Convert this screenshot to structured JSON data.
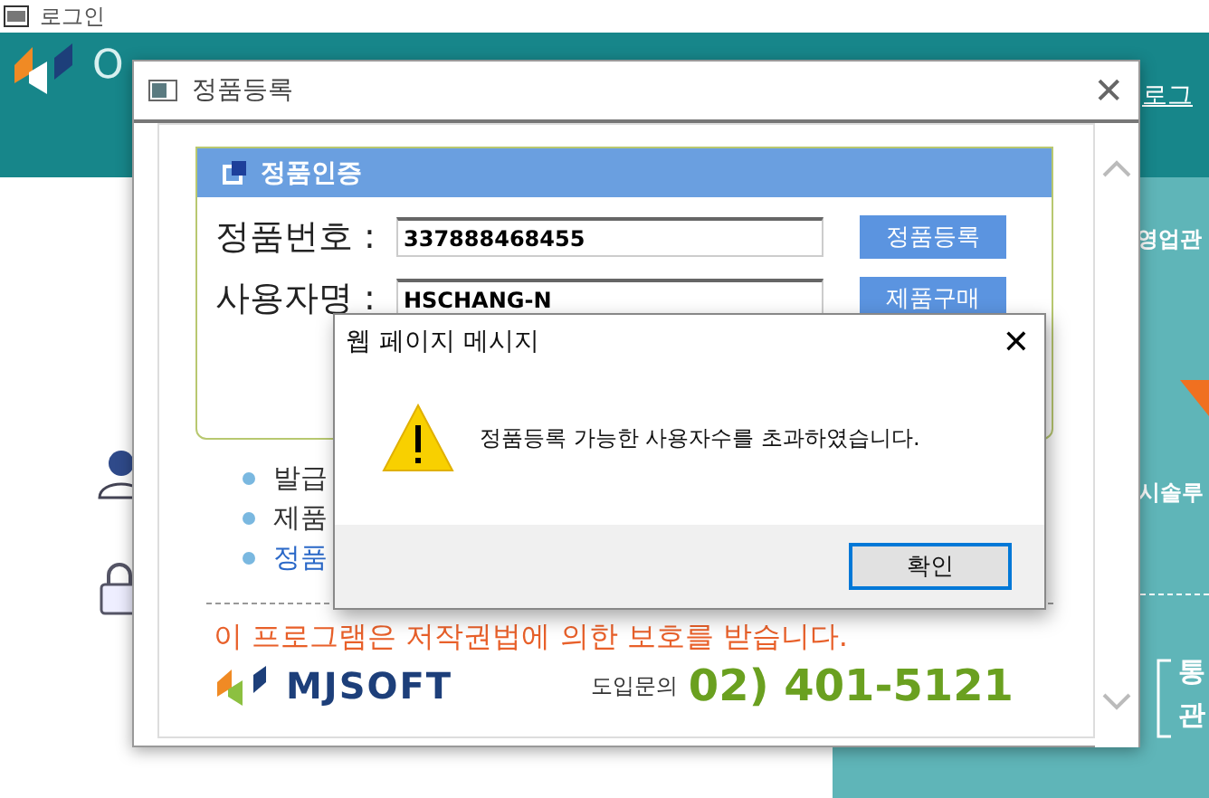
{
  "background_app": {
    "title": "로그인",
    "header_logo_text": "O",
    "login_link": "로그",
    "side_texts": [
      {
        "text": "영업관",
        "kind": "heading"
      },
      {
        "text": "시솔루",
        "kind": "heading"
      },
      {
        "text": "통",
        "kind": "bracket"
      },
      {
        "text": "관",
        "kind": "bracket"
      }
    ]
  },
  "registration_window": {
    "title": "정품등록",
    "close_icon": "✕",
    "panel_title": "정품인증",
    "fields": [
      {
        "label": "정품번호 :",
        "value": "337888468455",
        "button": "정품등록"
      },
      {
        "label": "사용자명 :",
        "value": "HSCHANG-N",
        "button": "제품구매"
      }
    ],
    "bullets": [
      {
        "text": "발급",
        "kind": "text"
      },
      {
        "text": "제품",
        "kind": "text"
      },
      {
        "text": "정품",
        "kind": "link"
      }
    ],
    "notice": "이 프로그램은 저작권법에 의한 보호를 받습니다.",
    "logo_text": "MJSOFT",
    "contact_label": "도입문의",
    "contact_phone": "02) 401-5121"
  },
  "message_dialog": {
    "title": "웹 페이지 메시지",
    "close_icon": "✕",
    "message": "정품등록 가능한 사용자수를 초과하였습니다.",
    "buttons": [
      {
        "label": "확인",
        "default": true
      }
    ]
  }
}
